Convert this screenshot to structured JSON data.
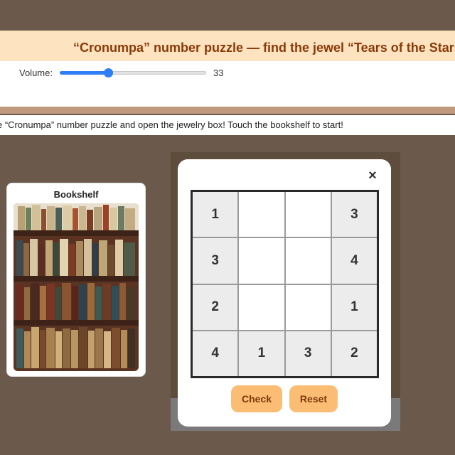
{
  "header": {
    "title": "“Cronumpa” number puzzle — find the jewel “Tears of the Stars”"
  },
  "volume": {
    "label": "Volume:",
    "value": 33,
    "value_text": "33",
    "accent_color": "#2d7ef7"
  },
  "instruction": {
    "text": "e “Cronumpa” number puzzle and open the jewelry box! Touch the bookshelf to start!"
  },
  "bookshelf": {
    "title": "Bookshelf"
  },
  "puzzle": {
    "close_icon": "×",
    "grid": [
      [
        "1",
        "",
        "",
        "3"
      ],
      [
        "3",
        "",
        "",
        "4"
      ],
      [
        "2",
        "",
        "",
        "1"
      ],
      [
        "4",
        "1",
        "3",
        "2"
      ]
    ],
    "check_label": "Check",
    "reset_label": "Reset"
  }
}
